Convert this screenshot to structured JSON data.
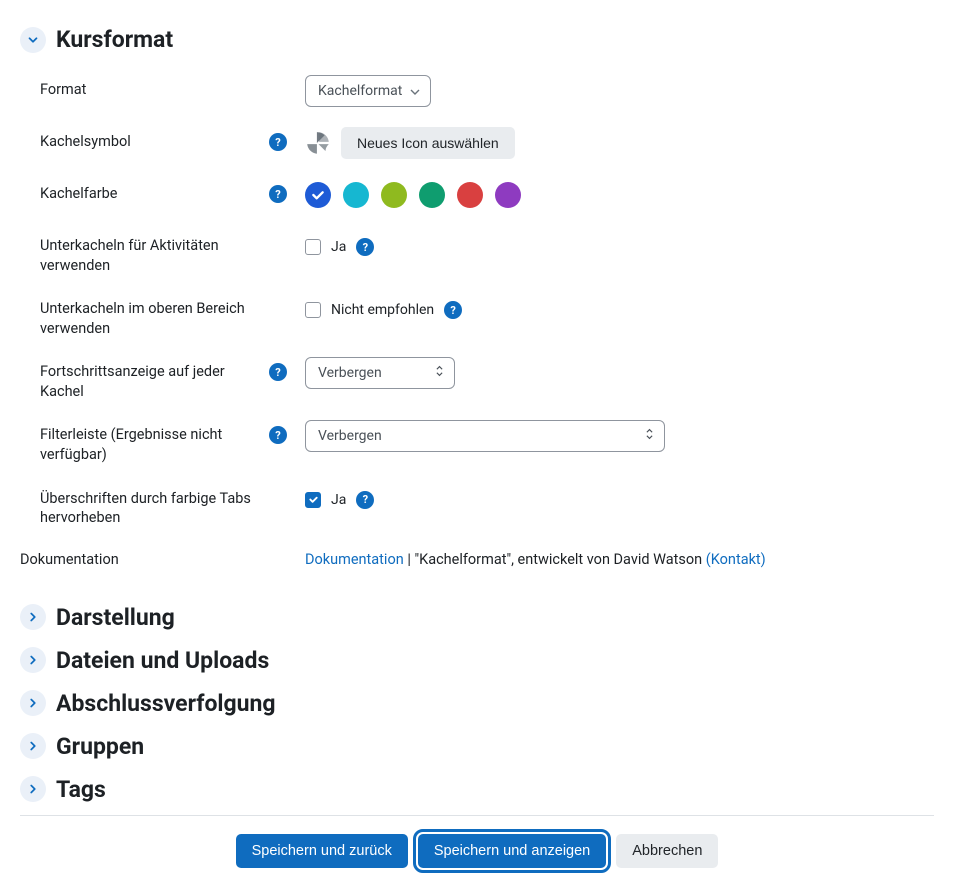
{
  "sections": {
    "kursformat": {
      "title": "Kursformat",
      "format": {
        "label": "Format",
        "value": "Kachelformat"
      },
      "kachelsymbol": {
        "label": "Kachelsymbol",
        "button": "Neues Icon auswählen",
        "icon": "pie-chart-icon"
      },
      "kachelfarbe": {
        "label": "Kachelfarbe",
        "colors": [
          "#1e5bd6",
          "#16b7d1",
          "#8fba1f",
          "#0f9d6f",
          "#d94040",
          "#8e3bc0"
        ],
        "selected": 0
      },
      "subtiles_activities": {
        "label": "Unterkacheln für Aktivitäten verwenden",
        "checkbox_label": "Ja",
        "checked": false
      },
      "subtiles_top": {
        "label": "Unterkacheln im oberen Bereich verwenden",
        "checkbox_label": "Nicht empfohlen",
        "checked": false
      },
      "progress": {
        "label": "Fortschrittsanzeige auf jeder Kachel",
        "value": "Verbergen"
      },
      "filterbar": {
        "label": "Filterleiste (Ergebnisse nicht verfügbar)",
        "value": "Verbergen"
      },
      "colored_tabs": {
        "label": "Überschriften durch farbige Tabs hervorheben",
        "checkbox_label": "Ja",
        "checked": true
      }
    },
    "documentation": {
      "label": "Dokumentation",
      "link": "Dokumentation",
      "text1": " | \"Kachelformat\", entwickelt von David Watson ",
      "contact": "(Kontakt)"
    },
    "collapsed": {
      "darstellung": "Darstellung",
      "dateien": "Dateien und Uploads",
      "abschluss": "Abschlussverfolgung",
      "gruppen": "Gruppen",
      "tags": "Tags"
    }
  },
  "actions": {
    "save_return": "Speichern und zurück",
    "save_show": "Speichern und anzeigen",
    "cancel": "Abbrechen"
  }
}
